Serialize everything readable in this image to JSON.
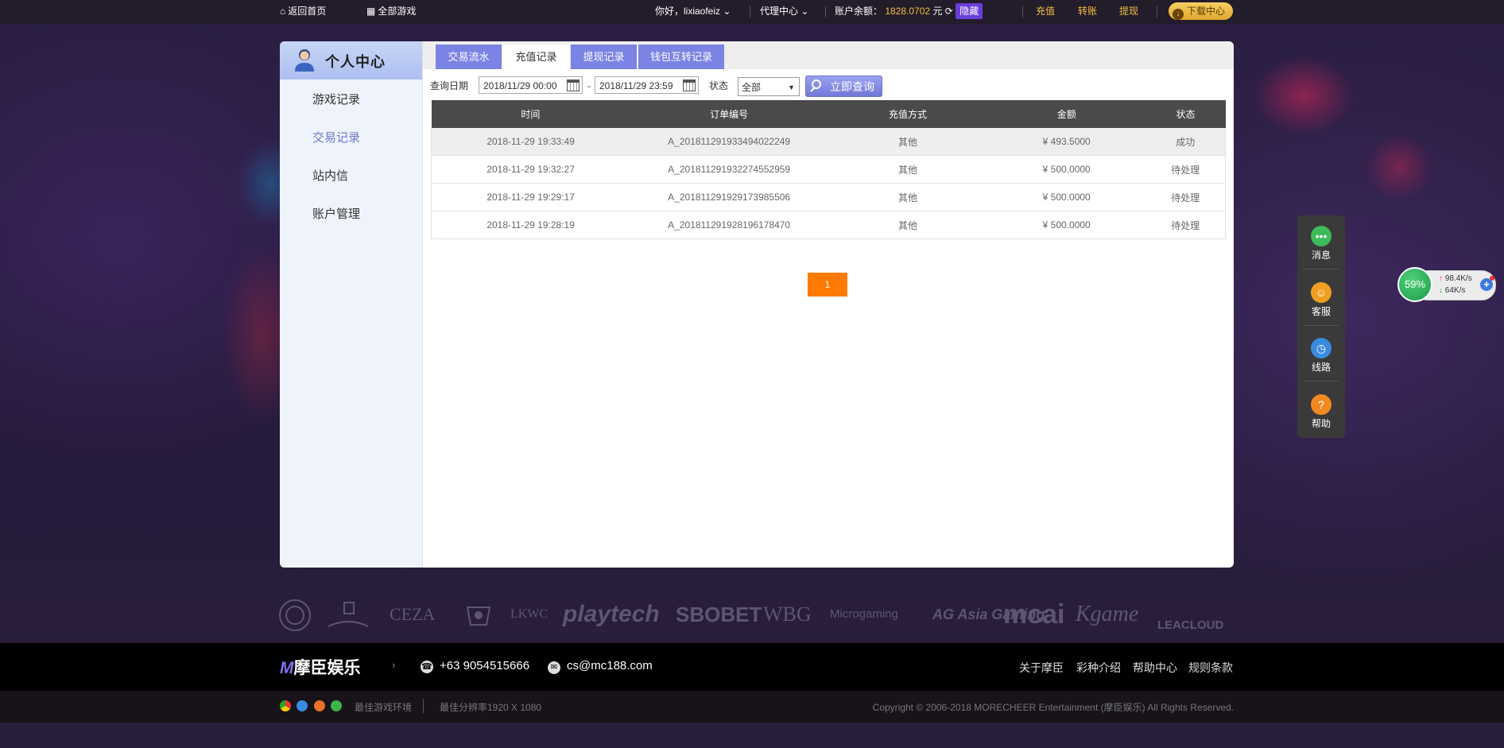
{
  "topbar": {
    "home_label": "返回首页",
    "games_label": "全部游戏",
    "greeting": "你好，lixiaofeiz",
    "agent_label": "代理中心",
    "balance_label": "账户余额：",
    "balance_value": "1828.0702",
    "balance_unit": "元",
    "hide_label": "隐藏",
    "deposit_label": "充值",
    "transfer_label": "转账",
    "withdraw_label": "提现",
    "download_label": "下载中心"
  },
  "sidebar": {
    "title": "个人中心",
    "items": [
      {
        "label": "游戏记录"
      },
      {
        "label": "交易记录"
      },
      {
        "label": "站内信"
      },
      {
        "label": "账户管理"
      }
    ]
  },
  "tabs": [
    {
      "label": "交易流水"
    },
    {
      "label": "充值记录"
    },
    {
      "label": "提现记录"
    },
    {
      "label": "钱包互转记录"
    }
  ],
  "filter": {
    "date_label": "查询日期",
    "start": "2018/11/29 00:00",
    "dash": "-",
    "end": "2018/11/29 23:59",
    "status_label": "状态",
    "status_value": "全部",
    "query_button": "立即查询"
  },
  "table": {
    "headers": [
      "时间",
      "订单编号",
      "充值方式",
      "金额",
      "状态"
    ],
    "rows": [
      [
        "2018-11-29 19:33:49",
        "A_201811291933494022249",
        "其他",
        "¥ 493.5000",
        "成功"
      ],
      [
        "2018-11-29 19:32:27",
        "A_201811291932274552959",
        "其他",
        "¥ 500.0000",
        "待处理"
      ],
      [
        "2018-11-29 19:29:17",
        "A_201811291929173985506",
        "其他",
        "¥ 500.0000",
        "待处理"
      ],
      [
        "2018-11-29 19:28:19",
        "A_201811291928196178470",
        "其他",
        "¥ 500.0000",
        "待处理"
      ]
    ]
  },
  "pagination": {
    "current": "1"
  },
  "logos": [
    "CEZA",
    "LKWC",
    "playtech",
    "SBOBET",
    "WBG",
    "Microgaming",
    "AG Asia Gaming",
    "mcai",
    "Kgame",
    "LEACLOUD"
  ],
  "footer": {
    "brand": "摩臣娱乐",
    "phone": "+63 9054515666",
    "email": "cs@mc188.com",
    "links": [
      "关于摩臣",
      "彩种介绍",
      "帮助中心",
      "规则条款"
    ],
    "best_env": "最佳游戏环境",
    "best_res": "最佳分辨率1920 X 1080",
    "copyright": "Copyright © 2006-2018 MORECHEER Entertainment (摩臣娱乐) All Rights Reserved."
  },
  "float_menu": [
    {
      "label": "消息",
      "icon": "chat-icon",
      "color": "#3dbb5a"
    },
    {
      "label": "客服",
      "icon": "agent-icon",
      "color": "#f0a020"
    },
    {
      "label": "线路",
      "icon": "route-icon",
      "color": "#3a8be0"
    },
    {
      "label": "帮助",
      "icon": "help-icon",
      "color": "#f08a20"
    }
  ],
  "speed": {
    "percent": "59%",
    "up": "98.4K/s",
    "down": "64K/s"
  },
  "colors": {
    "accent": "#7b83e4",
    "page": "#ff7a00",
    "balance": "#f0c040"
  }
}
